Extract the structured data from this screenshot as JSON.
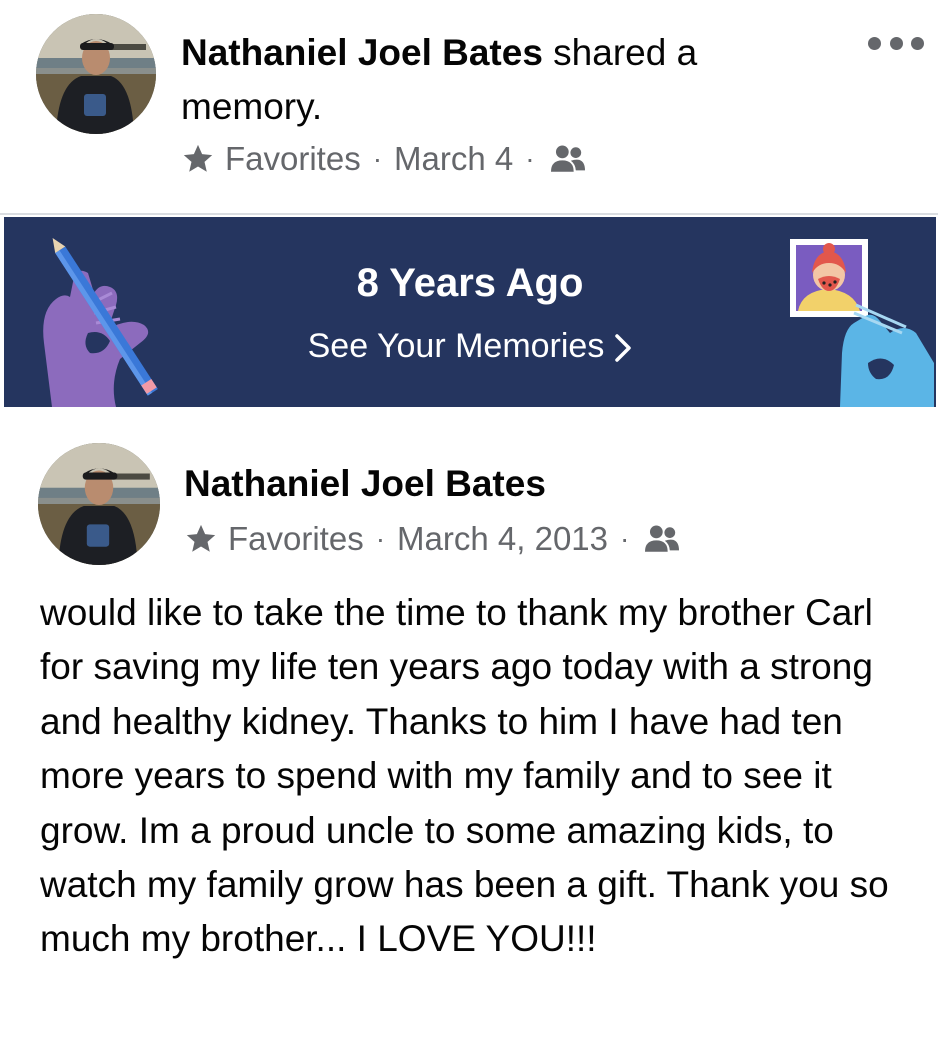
{
  "shared_header": {
    "author_name": "Nathaniel Joel Bates",
    "action_text": " shared a memory.",
    "audience_label": "Favorites",
    "date": "March 4",
    "audience_icon": "friends-icon",
    "more_icon": "more-options-icon"
  },
  "memory_banner": {
    "title": "8 Years Ago",
    "link_label": "See Your Memories",
    "colors": {
      "background": "#25355f",
      "left_hand": "#8c6bbd",
      "right_hand": "#5bb5e6",
      "pencil": "#3a78d8"
    }
  },
  "original_post": {
    "author_name": "Nathaniel Joel Bates",
    "audience_label": "Favorites",
    "date": "March 4, 2013",
    "audience_icon": "friends-icon",
    "text": "would like to take the time to thank my brother Carl for saving my life ten years ago today with a strong and healthy kidney. Thanks to him I have had ten more years to spend with my family and to see it grow. Im a proud uncle to some amazing kids, to watch my family grow has been a gift. Thank you so much my brother... I LOVE YOU!!!"
  }
}
